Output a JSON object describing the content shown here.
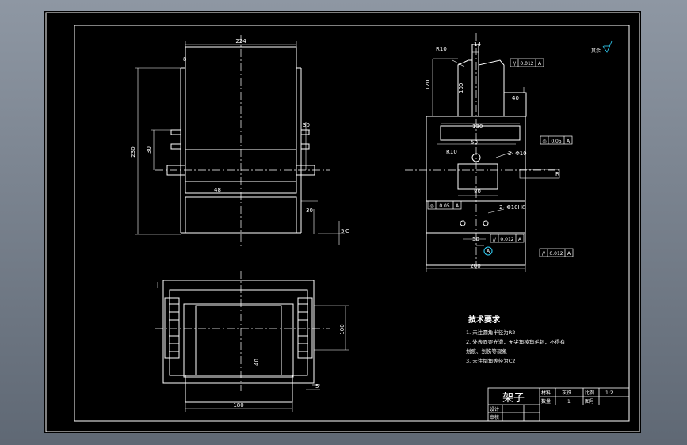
{
  "drawing": {
    "dims": {
      "front_width": "224",
      "front_height": "230",
      "front_side_30": "30",
      "front_hole_30": "30",
      "front_8": "8",
      "front_48": "48",
      "front_bottom_30": "30",
      "front_bottom_5": "5",
      "front_c": "C",
      "top_width": "180",
      "top_height": "100",
      "top_40": "40",
      "top_5": "5",
      "side_r10_top": "R10",
      "side_14": "14",
      "side_120": "120",
      "side_100": "100",
      "side_40": "40",
      "side_130": "130",
      "side_50": "50",
      "side_r10_mid": "R10",
      "side_hole_2": "2- Φ10",
      "side_80": "80",
      "side_hole_bottom": "2- Φ10H8",
      "side_50b": "50",
      "side_width": "200",
      "side_r_right": "R",
      "datum_a": "A"
    },
    "tolerances": [
      {
        "symbol": "//",
        "value": "0.012",
        "datum": "A"
      },
      {
        "symbol": "◎",
        "value": "0.05",
        "datum": "A"
      },
      {
        "symbol": "◎",
        "value": "0.05",
        "datum": "A"
      },
      {
        "symbol": "//",
        "value": "0.012",
        "datum": "A"
      },
      {
        "symbol": "//",
        "value": "0.012",
        "datum": "A"
      }
    ],
    "surface_note": "其余",
    "tech_requirements": {
      "title": "技术要求",
      "items": [
        "1. 未注圆角半径为R2",
        "2. 外表面要光滑，无尖角棱角毛刺，不得有",
        "   划痕、划伤等现象",
        "3. 未注倒角等径为C2"
      ]
    },
    "title_block": {
      "part_name": "架子",
      "material_label": "材料",
      "material_value": "灰铁",
      "scale_label": "比例",
      "scale_value": "1:2",
      "quantity_label": "数量",
      "quantity_value": "1",
      "drawing_no_label": "图号",
      "designer_label": "设计",
      "reviewer_label": "审核"
    }
  }
}
